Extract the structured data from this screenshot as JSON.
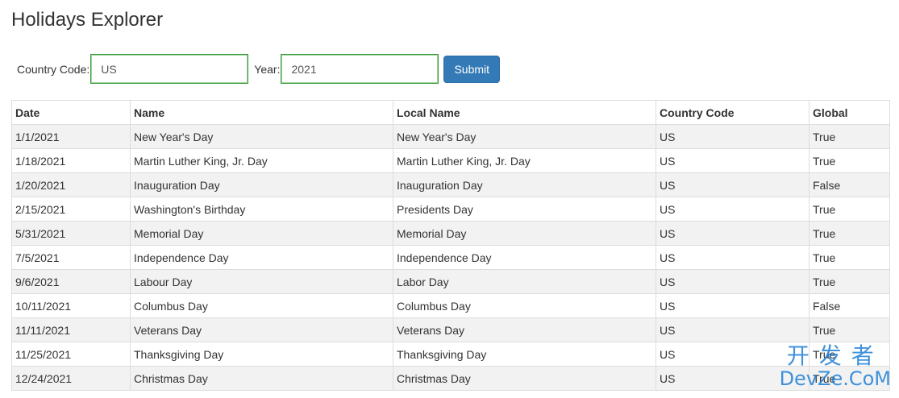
{
  "header": {
    "title": "Holidays Explorer"
  },
  "form": {
    "country_label": "Country Code:",
    "country_value": "US",
    "year_label": "Year:",
    "year_value": "2021",
    "submit_label": "Submit"
  },
  "table": {
    "headers": {
      "date": "Date",
      "name": "Name",
      "local_name": "Local Name",
      "country_code": "Country Code",
      "global": "Global"
    },
    "rows": [
      {
        "date": "1/1/2021",
        "name": "New Year's Day",
        "local_name": "New Year's Day",
        "country_code": "US",
        "global": "True"
      },
      {
        "date": "1/18/2021",
        "name": "Martin Luther King, Jr. Day",
        "local_name": "Martin Luther King, Jr. Day",
        "country_code": "US",
        "global": "True"
      },
      {
        "date": "1/20/2021",
        "name": "Inauguration Day",
        "local_name": "Inauguration Day",
        "country_code": "US",
        "global": "False"
      },
      {
        "date": "2/15/2021",
        "name": "Washington's Birthday",
        "local_name": "Presidents Day",
        "country_code": "US",
        "global": "True"
      },
      {
        "date": "5/31/2021",
        "name": "Memorial Day",
        "local_name": "Memorial Day",
        "country_code": "US",
        "global": "True"
      },
      {
        "date": "7/5/2021",
        "name": "Independence Day",
        "local_name": "Independence Day",
        "country_code": "US",
        "global": "True"
      },
      {
        "date": "9/6/2021",
        "name": "Labour Day",
        "local_name": "Labor Day",
        "country_code": "US",
        "global": "True"
      },
      {
        "date": "10/11/2021",
        "name": "Columbus Day",
        "local_name": "Columbus Day",
        "country_code": "US",
        "global": "False"
      },
      {
        "date": "11/11/2021",
        "name": "Veterans Day",
        "local_name": "Veterans Day",
        "country_code": "US",
        "global": "True"
      },
      {
        "date": "11/25/2021",
        "name": "Thanksgiving Day",
        "local_name": "Thanksgiving Day",
        "country_code": "US",
        "global": "True"
      },
      {
        "date": "12/24/2021",
        "name": "Christmas Day",
        "local_name": "Christmas Day",
        "country_code": "US",
        "global": "True"
      }
    ]
  },
  "watermark": {
    "line1": "开发者",
    "line2": "DevZe.CoM"
  },
  "colors": {
    "accent": "#337ab7",
    "input_border": "#3c9a3c",
    "stripe": "#f2f2f2",
    "watermark": "#1e7fd6"
  }
}
